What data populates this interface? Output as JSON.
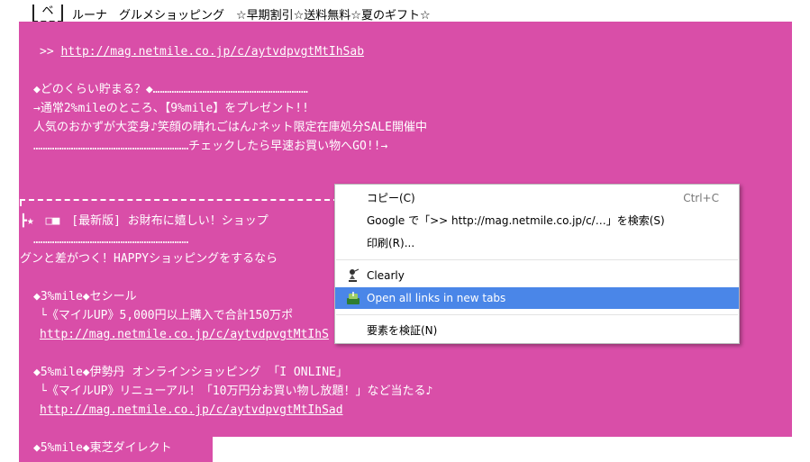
{
  "header": {
    "box_char": "ベ",
    "subject": "ルーナ　グルメショッピング　☆早期割引☆送料無料☆夏のギフト☆"
  },
  "email": {
    "link1_prefix": ">> ",
    "link1": "http://mag.netmile.co.jp/c/aytvdpvgtMtIhSab",
    "section_head": "◆どのくらい貯まる？◆…………………………………………………………",
    "line1": "→通常2%mileのところ、【9%mile】をプレゼント!!",
    "line2": "人気のおかずが大変身♪笑顔の晴れごはん♪ネット限定在庫処分SALE開催中",
    "line3": "…………………………………………………………チェックしたら早速お買い物へGO!!→",
    "banner": "┣★　□■　[最新版] お財布に嬉しい！ショップ",
    "banner_dots": "…………………………………………………………",
    "banner_sub": "グンと差がつく！HAPPYショッピングをするなら",
    "item1_title": "◆3%mile◆セシール",
    "item1_desc": "└《マイルUP》5,000円以上購入で合計150万ポ",
    "item1_link": "http://mag.netmile.co.jp/c/aytvdpvgtMtIhS",
    "item2_title": "◆5%mile◆伊勢丹 オンラインショッピング 「I ONLINE」",
    "item2_desc": "└《マイルUP》リニューアル！「10万円分お買い物し放題！」など当たる♪",
    "item2_link": "http://mag.netmile.co.jp/c/aytvdpvgtMtIhSad",
    "item3_title": "◆5%mile◆東芝ダイレクト"
  },
  "context_menu": {
    "copy_label": "コピー(C)",
    "copy_shortcut": "Ctrl+C",
    "search_label": "Google で「>> http://mag.netmile.co.jp/c/…」を検索(S)",
    "print_label": "印刷(R)...",
    "clearly_label": "Clearly",
    "open_links_label": "Open all links in new tabs",
    "inspect_label": "要素を検証(N)",
    "highlight_color": "#4a86e8"
  },
  "colors": {
    "pink": "#d94ea8"
  }
}
